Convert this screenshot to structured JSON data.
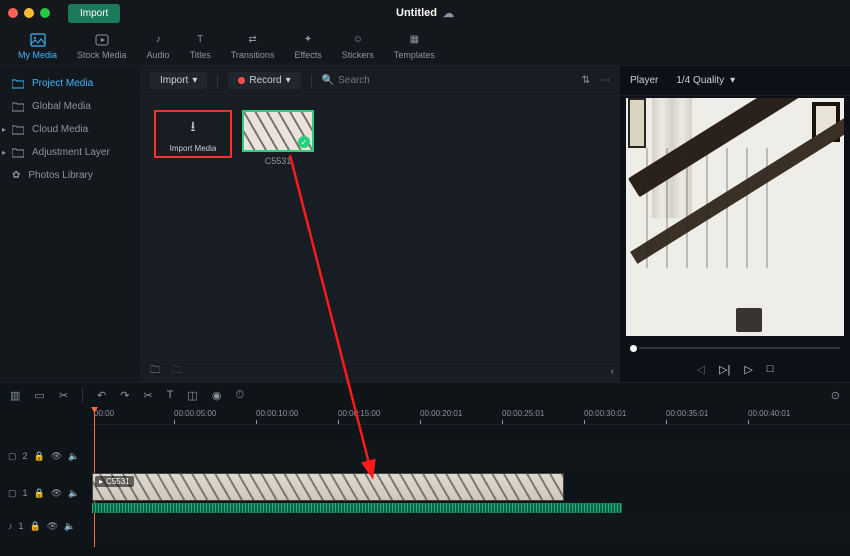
{
  "titlebar": {
    "import_label": "Import",
    "title": "Untitled"
  },
  "tabs": {
    "my_media": "My Media",
    "stock_media": "Stock Media",
    "audio": "Audio",
    "titles": "Titles",
    "transitions": "Transitions",
    "effects": "Effects",
    "stickers": "Stickers",
    "templates": "Templates"
  },
  "sidebar": {
    "project_media": "Project Media",
    "global_media": "Global Media",
    "cloud_media": "Cloud Media",
    "adjustment_layer": "Adjustment Layer",
    "photos_library": "Photos Library"
  },
  "center_toolbar": {
    "import_dd": "Import",
    "record_dd": "Record",
    "search_placeholder": "Search"
  },
  "media": {
    "import_card_label": "Import Media",
    "clip1_name": "C5531"
  },
  "preview": {
    "player_label": "Player",
    "quality_label": "1/4 Quality"
  },
  "timeline": {
    "ticks": [
      "00:00",
      "00:00:05:00",
      "00:00:10:00",
      "00:00:15:00",
      "00:00:20:01",
      "00:00:25:01",
      "00:00:30:01",
      "00:00:35:01",
      "00:00:40:01"
    ],
    "track2_label": "2",
    "track1_label": "1",
    "audio_track_label": "1",
    "clip_tag": "C5531"
  }
}
